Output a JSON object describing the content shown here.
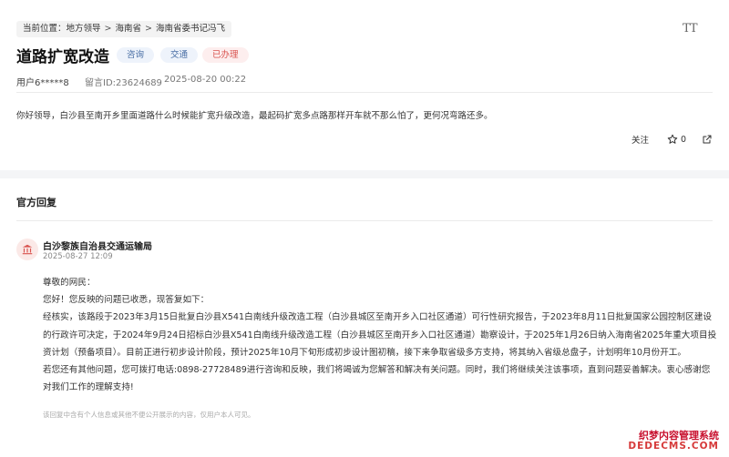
{
  "breadcrumb": {
    "prefix": "当前位置：",
    "items": [
      "地方领导",
      "海南省",
      "海南省委书记冯飞"
    ],
    "separator": ">"
  },
  "font_size_toggle": {
    "label": "TT",
    "icon": "font-size-icon"
  },
  "message": {
    "title": "道路扩宽改造",
    "tags": [
      {
        "label": "咨询",
        "color": "#4a6fa5"
      },
      {
        "label": "交通",
        "color": "#4a6fa5"
      },
      {
        "label": "已办理",
        "color": "#d9534f"
      }
    ],
    "user": "用户6*****8",
    "message_id": "留言ID:23624689",
    "time": "2025-08-20 00:22",
    "content": "你好领导，白沙县至南开乡里面道路什么时候能扩宽升级改造，最起码扩宽多点路那样开车就不那么怕了，更何况弯路还多。"
  },
  "actions": {
    "follow_label": "关注",
    "star_count": "0",
    "star_icon": "star-icon",
    "share_icon": "share-icon"
  },
  "reply_section": {
    "title": "官方回复",
    "department": "白沙黎族自治县交通运输局",
    "department_icon": "government-building-icon",
    "time": "2025-08-27 12:09",
    "lines": [
      "尊敬的网民：",
      "您好！您反映的问题已收悉，现答复如下：",
      "经核实，该路段于2023年3月15日批复白沙县X541白南线升级改造工程（白沙县城区至南开乡入口社区通道）可行性研究报告，于2023年8月11日批复国家公园控制区建设",
      "的行政许可决定，于2024年9月24日招标白沙县X541白南线升级改造工程（白沙县城区至南开乡入口社区通道）勘察设计，于2025年1月26日纳入海南省2025年重大项目投",
      "资计划（预备项目）。目前正进行初步设计阶段，预计2025年10月下旬形成初步设计图初稿，接下来争取省级多方支持，将其纳入省级总盘子，计划明年10月份开工。",
      "若您还有其他问题，您可拨打电话:0898-27728489进行咨询和反映，我们将竭诚为您解答和解决有关问题。同时，我们将继续关注该事项，直到问题妥善解决。衷心感谢您",
      "对我们工作的理解支持!"
    ],
    "note": "该回复中含有个人信息或其他不便公开展示的内容，仅用户本人可见。"
  },
  "watermark": {
    "line1": "织梦内容管理系统",
    "line2": "DEDECMS.COM"
  },
  "colors": {
    "tag_blue_bg": "#eef3fb",
    "tag_red_bg": "#fdeeee",
    "accent_red": "#d9534f"
  }
}
